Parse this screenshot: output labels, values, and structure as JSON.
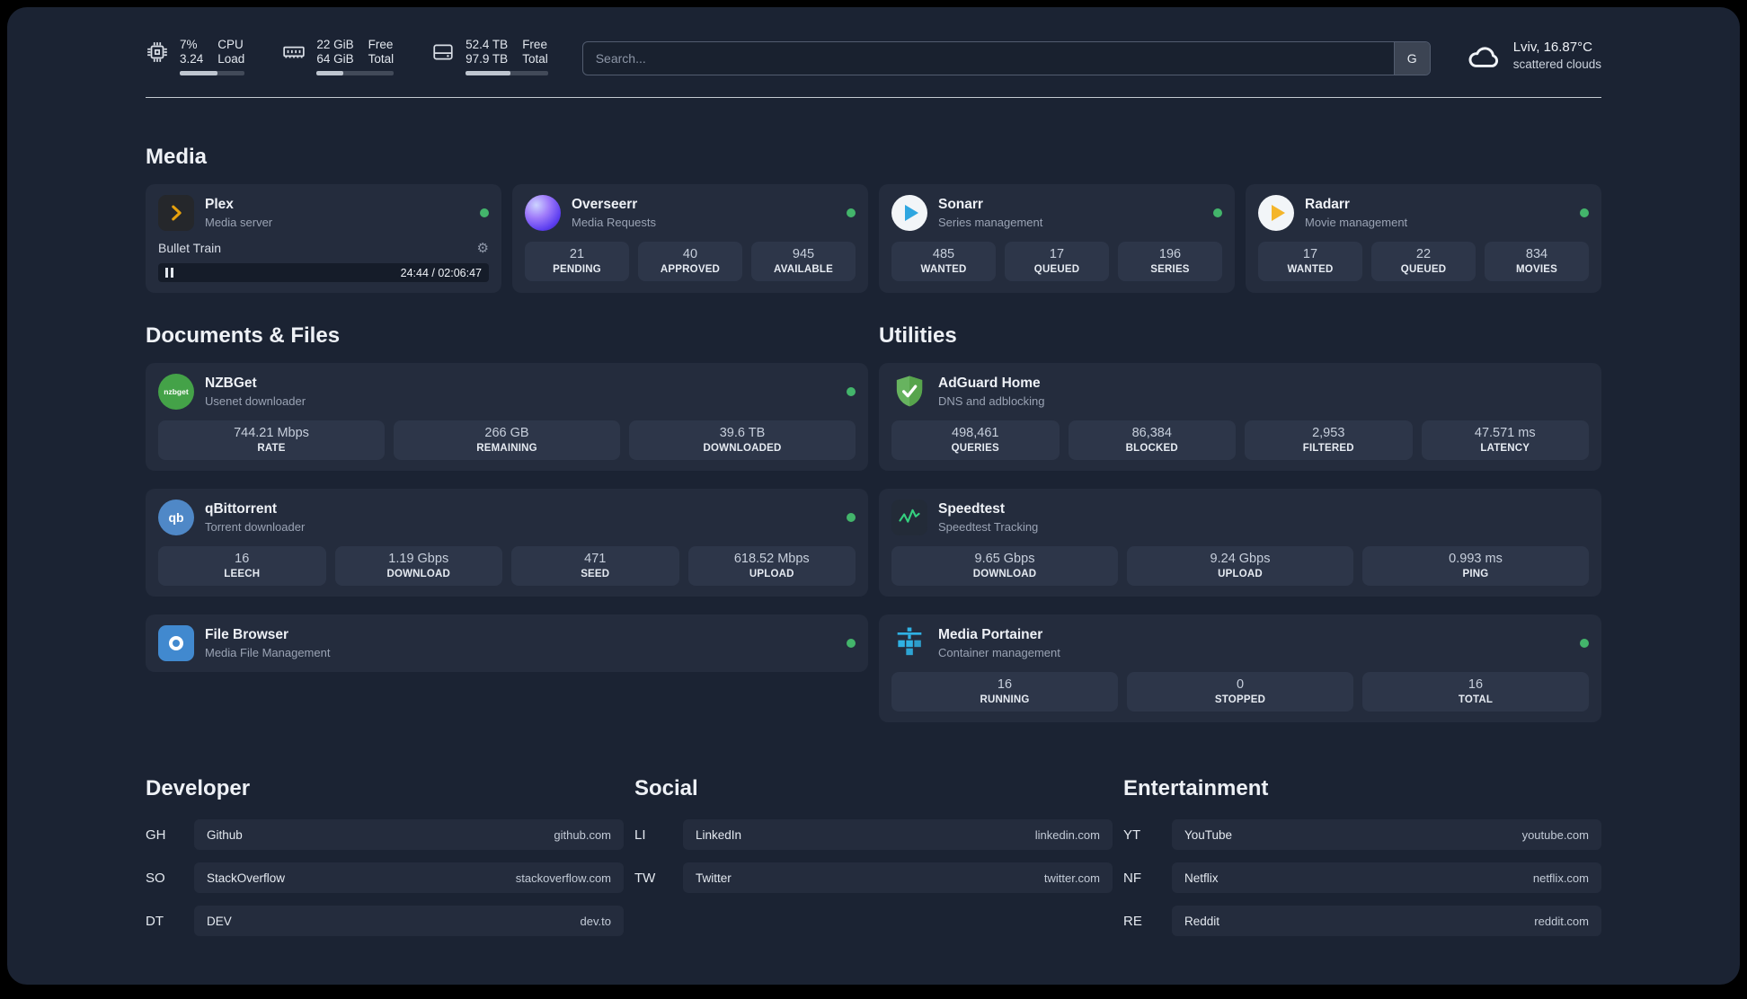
{
  "topbar": {
    "cpu": {
      "row1_value": "7%",
      "row1_label": "CPU",
      "row2_value": "3.24",
      "row2_label": "Load",
      "bar_percent": 58
    },
    "ram": {
      "row1_value": "22 GiB",
      "row1_label": "Free",
      "row2_value": "64 GiB",
      "row2_label": "Total",
      "bar_percent": 34
    },
    "disk": {
      "row1_value": "52.4 TB",
      "row1_label": "Free",
      "row2_value": "97.9 TB",
      "row2_label": "Total",
      "bar_percent": 54
    },
    "search": {
      "placeholder": "Search...",
      "engine_label": "G"
    },
    "weather": {
      "location": "Lviv, 16.87°C",
      "condition": "scattered clouds"
    }
  },
  "sections": {
    "media": {
      "title": "Media",
      "apps": [
        {
          "name": "Plex",
          "subtitle": "Media server",
          "online": true,
          "player": {
            "title": "Bullet Train",
            "time": "24:44 / 02:06:47",
            "progress_percent": 16
          }
        },
        {
          "name": "Overseerr",
          "subtitle": "Media Requests",
          "online": true,
          "stats": [
            {
              "value": "21",
              "label": "PENDING"
            },
            {
              "value": "40",
              "label": "APPROVED"
            },
            {
              "value": "945",
              "label": "AVAILABLE"
            }
          ]
        },
        {
          "name": "Sonarr",
          "subtitle": "Series management",
          "online": true,
          "stats": [
            {
              "value": "485",
              "label": "WANTED"
            },
            {
              "value": "17",
              "label": "QUEUED"
            },
            {
              "value": "196",
              "label": "SERIES"
            }
          ]
        },
        {
          "name": "Radarr",
          "subtitle": "Movie management",
          "online": true,
          "stats": [
            {
              "value": "17",
              "label": "WANTED"
            },
            {
              "value": "22",
              "label": "QUEUED"
            },
            {
              "value": "834",
              "label": "MOVIES"
            }
          ]
        }
      ]
    },
    "documents": {
      "title": "Documents & Files",
      "apps": [
        {
          "name": "NZBGet",
          "subtitle": "Usenet downloader",
          "online": true,
          "icon_text": "nzbget",
          "stats": [
            {
              "value": "744.21 Mbps",
              "label": "RATE"
            },
            {
              "value": "266 GB",
              "label": "REMAINING"
            },
            {
              "value": "39.6 TB",
              "label": "DOWNLOADED"
            }
          ]
        },
        {
          "name": "qBittorrent",
          "subtitle": "Torrent downloader",
          "online": true,
          "icon_text": "qb",
          "stats": [
            {
              "value": "16",
              "label": "LEECH"
            },
            {
              "value": "1.19 Gbps",
              "label": "DOWNLOAD"
            },
            {
              "value": "471",
              "label": "SEED"
            },
            {
              "value": "618.52 Mbps",
              "label": "UPLOAD"
            }
          ]
        },
        {
          "name": "File Browser",
          "subtitle": "Media File Management",
          "online": true,
          "stats": []
        }
      ]
    },
    "utilities": {
      "title": "Utilities",
      "apps": [
        {
          "name": "AdGuard Home",
          "subtitle": "DNS and adblocking",
          "online": false,
          "stats": [
            {
              "value": "498,461",
              "label": "QUERIES"
            },
            {
              "value": "86,384",
              "label": "BLOCKED"
            },
            {
              "value": "2,953",
              "label": "FILTERED"
            },
            {
              "value": "47.571 ms",
              "label": "LATENCY"
            }
          ]
        },
        {
          "name": "Speedtest",
          "subtitle": "Speedtest Tracking",
          "online": false,
          "stats": [
            {
              "value": "9.65 Gbps",
              "label": "DOWNLOAD"
            },
            {
              "value": "9.24 Gbps",
              "label": "UPLOAD"
            },
            {
              "value": "0.993 ms",
              "label": "PING"
            }
          ]
        },
        {
          "name": "Media Portainer",
          "subtitle": "Container management",
          "online": true,
          "stats": [
            {
              "value": "16",
              "label": "RUNNING"
            },
            {
              "value": "0",
              "label": "STOPPED"
            },
            {
              "value": "16",
              "label": "TOTAL"
            }
          ]
        }
      ]
    }
  },
  "bookmarks": [
    {
      "title": "Developer",
      "links": [
        {
          "abbr": "GH",
          "name": "Github",
          "url": "github.com"
        },
        {
          "abbr": "SO",
          "name": "StackOverflow",
          "url": "stackoverflow.com"
        },
        {
          "abbr": "DT",
          "name": "DEV",
          "url": "dev.to"
        }
      ]
    },
    {
      "title": "Social",
      "links": [
        {
          "abbr": "LI",
          "name": "LinkedIn",
          "url": "linkedin.com"
        },
        {
          "abbr": "TW",
          "name": "Twitter",
          "url": "twitter.com"
        }
      ]
    },
    {
      "title": "Entertainment",
      "links": [
        {
          "abbr": "YT",
          "name": "YouTube",
          "url": "youtube.com"
        },
        {
          "abbr": "NF",
          "name": "Netflix",
          "url": "netflix.com"
        },
        {
          "abbr": "RE",
          "name": "Reddit",
          "url": "reddit.com"
        }
      ]
    }
  ],
  "colors": {
    "status_online": "#43b56b",
    "plex_accent": "#e5a00d",
    "background": "#1b2333",
    "card": "#242c3d"
  }
}
